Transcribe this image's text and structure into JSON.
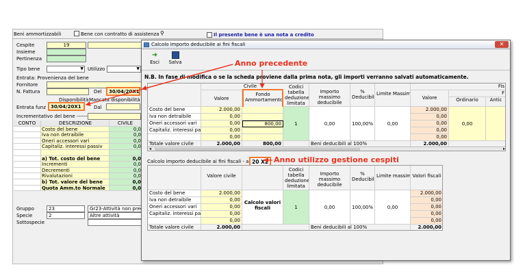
{
  "form": {
    "header_title": "Beni ammortizzabili",
    "chk_assistenza": "Bene con contratto di assistenza",
    "chk_nota_credito": "Il presente bene è una nota a credito",
    "cespite_label": "Cespite",
    "cespite_value": "19",
    "insieme_label": "Insieme",
    "pertinenza_label": "Pertinenza",
    "tipo_bene_label": "Tipo bene",
    "utilizzo_label": "Utilizzo",
    "entrata_label": "Entrata: Provenienza del bene",
    "fornitore_label": "Fornitore",
    "nfattura_label": "N. Fattura",
    "del_label": "Del",
    "del_value": "30/04/20X1",
    "disponibilita_label": "Disponibilità",
    "mancata_label": "Mancata disponibilità",
    "entrata_funz_label": "Entrata funz",
    "entrata_funz_value": "30/04/20X1",
    "dal_label": "Dal",
    "incrementativo_label": "Incrementativo del bene ------->",
    "table_headers": [
      "CONTO",
      "DESCRIZIONE",
      "CIVILE"
    ],
    "table_rows": [
      {
        "desc": "Costo del bene",
        "val": "0,0"
      },
      {
        "desc": "Iva non detraibile",
        "val": "0,0"
      },
      {
        "desc": "Oneri accessori vari",
        "val": "0,0"
      },
      {
        "desc": "Capitaliz. interessi passiv",
        "val": "0,0"
      },
      {
        "desc": "",
        "val": ""
      },
      {
        "desc": "a) Tot. costo del bene",
        "val": "0,0"
      },
      {
        "desc": "Incrementi",
        "val": "0,0"
      },
      {
        "desc": "Decrementi",
        "val": "0,0"
      },
      {
        "desc": "Rivalutazioni",
        "val": "0,0"
      },
      {
        "desc": "b) Tot. valore del bene",
        "val": "0,0"
      },
      {
        "desc": "Quota Amm.to Normale",
        "val": "0,0"
      }
    ],
    "gruppo_label": "Gruppo",
    "gruppo_value": "23",
    "gruppo_desc": "Gr23-Attività non prec",
    "specie_label": "Specie",
    "specie_value": "2",
    "specie_desc": "Altre attività",
    "sottospecie_label": "Sottospecie"
  },
  "dialog": {
    "title": "Calcolo importo deducibile ai fini fiscali",
    "btn_esci": "Esci",
    "btn_salva": "Salva",
    "note": "N.B. In fase di modifica o se la scheda proviene dalla prima nota, gli importi verranno salvati automaticamente.",
    "civile_header": "Civile",
    "col_valore": "Valore",
    "col_fondo": "Fondo Ammortamento",
    "col_codici": "Codici tabella deduzione limitata",
    "col_importo_max": "Importo massimo deducibile",
    "col_perc": "% Deducibile",
    "col_limite": "Limite Massimo",
    "col_fis": "Fis",
    "col_fiscal_valore": "Valore",
    "col_ordinario": "Ordinario",
    "col_antic": "Antic",
    "col_f": "F",
    "rows1": [
      {
        "label": "Costo del bene",
        "valore": "2.000,00",
        "fondo": "",
        "fiscal": "2.000,00"
      },
      {
        "label": "Iva non detraibile",
        "valore": "0,00",
        "fondo": "",
        "fiscal": "0,00"
      },
      {
        "label": "Oneri accessori vari",
        "valore": "0,00",
        "fondo": "800,00",
        "fiscal": "0,00"
      },
      {
        "label": "Capitaliz. interessi passivi",
        "valore": "0,00",
        "fondo": "",
        "fiscal": "0,00"
      },
      {
        "label": "",
        "valore": "0,00",
        "fondo": "",
        "fiscal": "0,00"
      }
    ],
    "codice1": "1",
    "importo1": "0,00",
    "perc1": "100,00%",
    "limite1": "0,00",
    "ordinario1": "0,00",
    "tot1_label": "Totale valore civile",
    "tot1_valore": "2.000,00",
    "tot1_fondo": "800,00",
    "tot1_beni": "Beni deducibili al 100%",
    "tot1_fiscal": "2.000,00",
    "section2_title": "Calcolo importo deducibile ai fini fiscali - anno",
    "section2_year": "20 X2",
    "col2_valore_civile": "Valore civile",
    "col2_codici": "Codici tabella deduzione limitata",
    "col2_importo": "Importo massimo deducibile",
    "col2_perc": "% Deducibile",
    "col2_limite": "Limite massimo",
    "col2_valori_fiscali": "Valori fiscali",
    "rows2": [
      {
        "label": "Costo del bene",
        "valore": "2.000,00",
        "fiscal": "2.000,00"
      },
      {
        "label": "Iva non detraibile",
        "valore": "0,00",
        "fiscal": "0,00"
      },
      {
        "label": "Oneri accessori vari",
        "valore": "0,00",
        "fiscal": "0,00"
      },
      {
        "label": "Capitaliz. interessi passivi",
        "valore": "0,00",
        "fiscal": "0,00"
      },
      {
        "label": "",
        "valore": "0,00",
        "fiscal": "0,00"
      }
    ],
    "calcolo_btn": "Calcolo valori fiscali",
    "codice2": "1",
    "importo2": "0,00",
    "perc2": "100,00%",
    "limite2": "0,00",
    "tot2_label": "Totale valore civile",
    "tot2_valore": "2.000,00",
    "tot2_beni": "Beni deducibili al 100%",
    "tot2_fiscal": "2.000,00"
  },
  "annotations": {
    "anno_precedente": "Anno precedente",
    "anno_utilizzo": "Anno utilizzo gestione cespiti"
  },
  "colors": {
    "highlight": "#f27a2e",
    "annotation": "#e6321e"
  }
}
